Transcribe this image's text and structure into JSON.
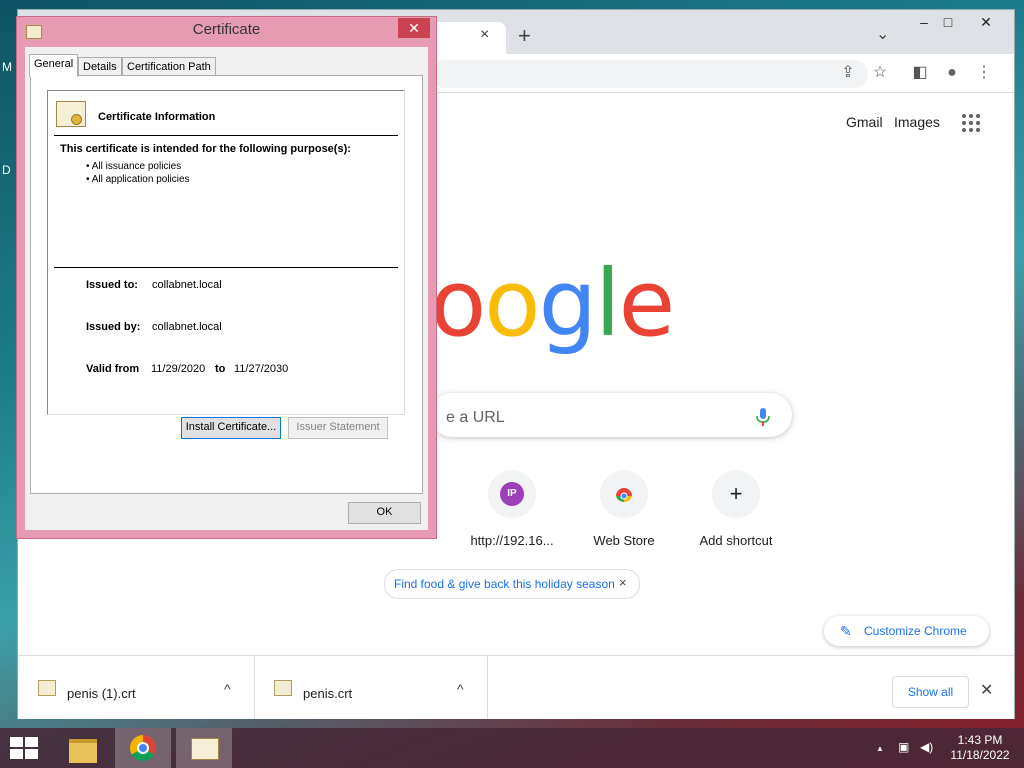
{
  "desktop": {
    "edge_labels": [
      "M",
      "D"
    ]
  },
  "browser": {
    "tab_close": "×",
    "new_tab": "+",
    "tab_search": "⌄",
    "window_controls": {
      "minimize": "–",
      "maximize": "□",
      "close": "✕"
    },
    "toolbar_icons": {
      "share": "⇪",
      "bookmark": "☆",
      "side_panel": "◧",
      "profile": "●",
      "menu": "⋮"
    },
    "top_links": {
      "gmail": "Gmail",
      "images": "Images"
    },
    "logo_text": "oogle",
    "search_placeholder": "e a URL",
    "shortcuts": [
      {
        "label": "http://192.16...",
        "badge": "IP"
      },
      {
        "label": "Web Store"
      },
      {
        "label": "Add shortcut",
        "symbol": "+"
      }
    ],
    "promo_chip": {
      "label": "Find food & give back this holiday season",
      "close": "×"
    },
    "customize_button": "Customize Chrome",
    "downloads": {
      "items": [
        {
          "name": "penis (1).crt"
        },
        {
          "name": "penis.crt"
        }
      ],
      "caret": "^",
      "show_all": "Show all",
      "close": "✕"
    }
  },
  "certificate_dialog": {
    "title": "Certificate",
    "close": "✕",
    "tabs": [
      "General",
      "Details",
      "Certification Path"
    ],
    "info_title": "Certificate Information",
    "purpose_heading": "This certificate is intended for the following purpose(s):",
    "purposes": [
      "• All issuance policies",
      "• All application policies"
    ],
    "issued_to_label": "Issued to:",
    "issued_to": "collabnet.local",
    "issued_by_label": "Issued by:",
    "issued_by": "collabnet.local",
    "valid_from_label": "Valid from",
    "valid_from": "11/29/2020",
    "to_label": "to",
    "valid_to": "11/27/2030",
    "install_button": "Install Certificate...",
    "issuer_statement_button": "Issuer Statement",
    "ok_button": "OK"
  },
  "taskbar": {
    "tray_caret": "▲",
    "clock_time": "1:43 PM",
    "clock_date": "11/18/2022"
  },
  "colors": {
    "google_blue": "#4285f4",
    "google_red": "#ea4335",
    "google_yellow": "#fbbc05",
    "google_green": "#34a853",
    "dialog_frame": "#e69bb3"
  }
}
